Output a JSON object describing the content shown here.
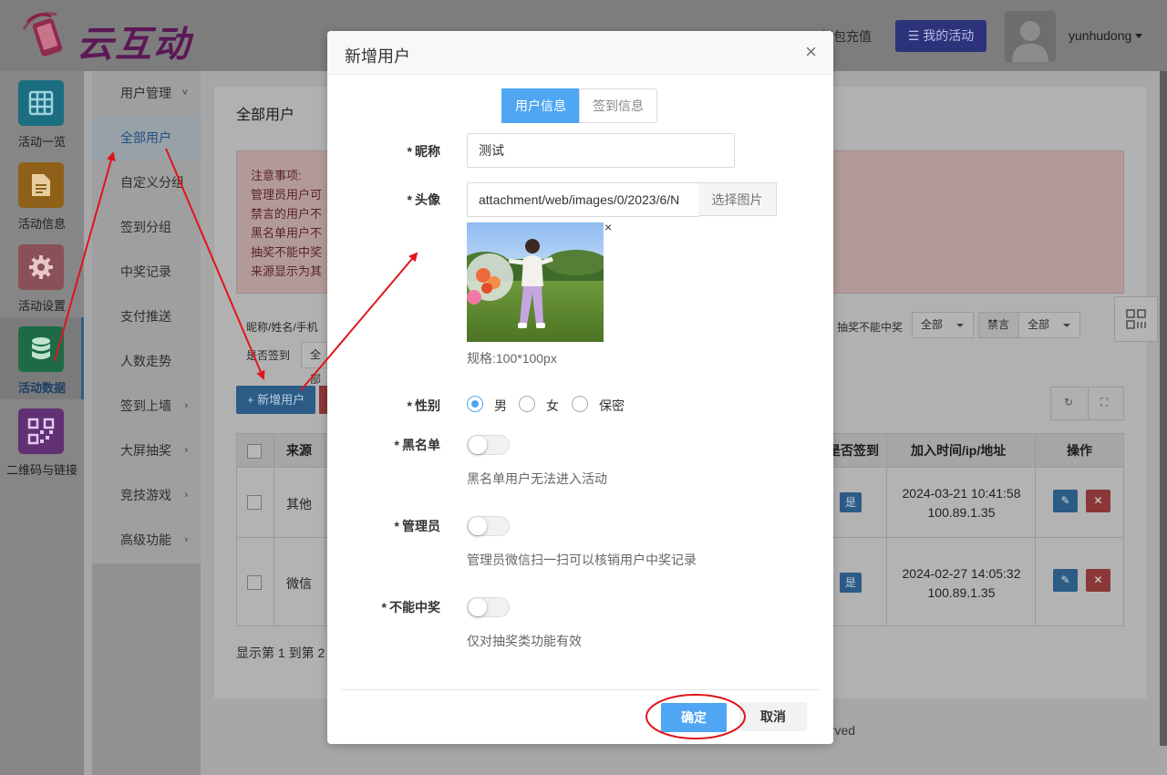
{
  "header": {
    "logo_text": "云互动",
    "recharge_label": "红包充值",
    "my_activity_label": "我的活动",
    "username": "yunhudong"
  },
  "side_nav": [
    {
      "label": "活动一览",
      "icon": "grid-icon",
      "color": "#1ca7c6"
    },
    {
      "label": "活动信息",
      "icon": "document-icon",
      "color": "#e8961a"
    },
    {
      "label": "活动设置",
      "icon": "gear-icon",
      "color": "#d76b7a"
    },
    {
      "label": "活动数据",
      "icon": "database-icon",
      "color": "#27a86a"
    },
    {
      "label": "二维码与链接",
      "icon": "qrcode-icon",
      "color": "#9a3fc1"
    }
  ],
  "sub_menu": [
    {
      "label": "用户管理",
      "arrow": "˅"
    },
    {
      "label": "全部用户",
      "arrow": ""
    },
    {
      "label": "自定义分组",
      "arrow": ""
    },
    {
      "label": "签到分组",
      "arrow": ""
    },
    {
      "label": "中奖记录",
      "arrow": ""
    },
    {
      "label": "支付推送",
      "arrow": ""
    },
    {
      "label": "人数走势",
      "arrow": ""
    },
    {
      "label": "签到上墙",
      "arrow": "›"
    },
    {
      "label": "大屏抽奖",
      "arrow": "›"
    },
    {
      "label": "竞技游戏",
      "arrow": "›"
    },
    {
      "label": "高级功能",
      "arrow": "›"
    }
  ],
  "content": {
    "title": "全部用户",
    "notice_lines": [
      "注意事项:",
      "管理员用户可",
      "禁言的用户不",
      "黑名单用户不",
      "抽奖不能中奖",
      "来源显示为其"
    ],
    "filters": {
      "nickname_label": "昵称/姓名/手机",
      "signed_label": "是否签到",
      "signed_value": "全部",
      "no_win_label": "抽奖不能中奖",
      "no_win_value": "全部",
      "mute_label": "禁言",
      "mute_value": "全部"
    },
    "add_button": "+ 新增用户",
    "table": {
      "headers": {
        "source": "来源",
        "signed": "是否签到",
        "join": "加入时间/ip/地址",
        "ops": "操作"
      },
      "rows": [
        {
          "source": "其他",
          "signed": "是",
          "time": "2024-03-21 10:41:58",
          "ip": "100.89.1.35"
        },
        {
          "source": "微信",
          "signed": "是",
          "time": "2024-02-27 14:05:32",
          "ip": "100.89.1.35"
        }
      ]
    },
    "pager": "显示第 1 到第 2",
    "footer": "erved"
  },
  "modal": {
    "title": "新增用户",
    "close": "×",
    "tabs": [
      "用户信息",
      "签到信息"
    ],
    "nickname": {
      "label": "昵称",
      "value": "测试"
    },
    "avatar": {
      "label": "头像",
      "value": "attachment/web/images/0/2023/6/N",
      "pick": "选择图片",
      "remove": "×",
      "hint": "规格:100*100px"
    },
    "gender": {
      "label": "性别",
      "options": [
        "男",
        "女",
        "保密"
      ],
      "selected": "男"
    },
    "blacklist": {
      "label": "黑名单",
      "hint": "黑名单用户无法进入活动"
    },
    "admin": {
      "label": "管理员",
      "hint": "管理员微信扫一扫可以核销用户中奖记录"
    },
    "no_win": {
      "label": "不能中奖",
      "hint": "仅对抽奖类功能有效"
    },
    "required_mark": "*",
    "ok": "确定",
    "cancel": "取消"
  },
  "annotation_color": "#e0141c"
}
